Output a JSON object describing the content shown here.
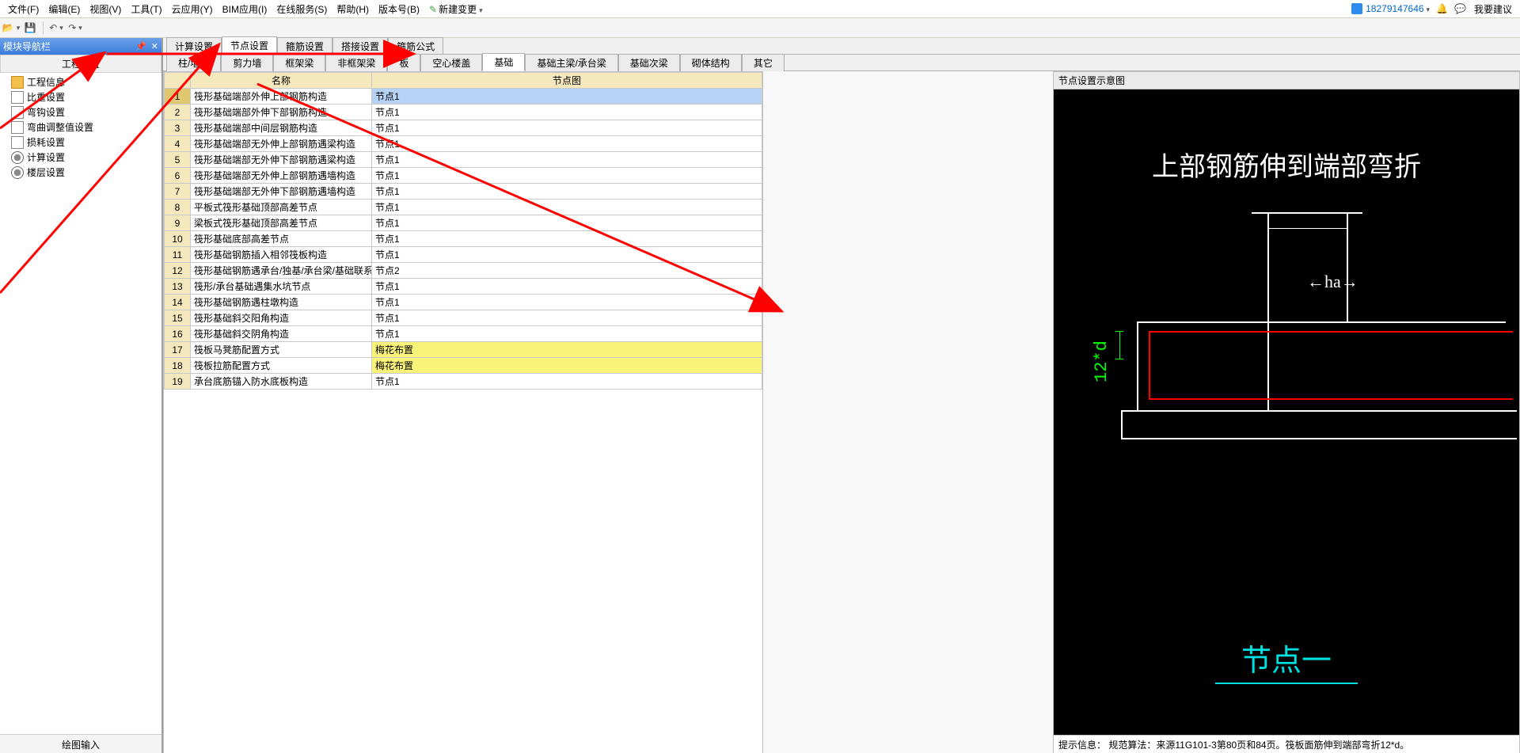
{
  "domain": "Computer-Use",
  "menus": {
    "file": "文件(F)",
    "edit": "编辑(E)",
    "view": "视图(V)",
    "tools": "工具(T)",
    "cloud": "云应用(Y)",
    "bim": "BIM应用(I)",
    "online": "在线服务(S)",
    "help": "帮助(H)",
    "version": "版本号(B)",
    "newchange": "新建变更"
  },
  "menubar_right": {
    "user_id": "18279147646",
    "feedback": "我要建议"
  },
  "nav": {
    "panel_title": "模块导航栏",
    "section": "工程设置",
    "footer": "绘图输入",
    "items": [
      "工程信息",
      "比重设置",
      "弯钩设置",
      "弯曲调整值设置",
      "损耗设置",
      "计算设置",
      "楼层设置"
    ]
  },
  "top_tabs": [
    "计算设置",
    "节点设置",
    "箍筋设置",
    "搭接设置",
    "箍筋公式"
  ],
  "top_tabs_active": 1,
  "sub_tabs": [
    "柱/墙柱",
    "剪力墙",
    "框架梁",
    "非框架梁",
    "板",
    "空心楼盖",
    "基础",
    "基础主梁/承台梁",
    "基础次梁",
    "砌体结构",
    "其它"
  ],
  "sub_tabs_active": 6,
  "table": {
    "headers": {
      "name": "名称",
      "img": "节点图"
    },
    "rows": [
      {
        "idx": 1,
        "name": "筏形基础端部外伸上部钢筋构造",
        "img": "节点1",
        "sel": true
      },
      {
        "idx": 2,
        "name": "筏形基础端部外伸下部钢筋构造",
        "img": "节点1"
      },
      {
        "idx": 3,
        "name": "筏形基础端部中间层钢筋构造",
        "img": "节点1"
      },
      {
        "idx": 4,
        "name": "筏形基础端部无外伸上部钢筋遇梁构造",
        "img": "节点1"
      },
      {
        "idx": 5,
        "name": "筏形基础端部无外伸下部钢筋遇梁构造",
        "img": "节点1"
      },
      {
        "idx": 6,
        "name": "筏形基础端部无外伸上部钢筋遇墙构造",
        "img": "节点1"
      },
      {
        "idx": 7,
        "name": "筏形基础端部无外伸下部钢筋遇墙构造",
        "img": "节点1"
      },
      {
        "idx": 8,
        "name": "平板式筏形基础顶部高差节点",
        "img": "节点1"
      },
      {
        "idx": 9,
        "name": "梁板式筏形基础顶部高差节点",
        "img": "节点1"
      },
      {
        "idx": 10,
        "name": "筏形基础底部高差节点",
        "img": "节点1"
      },
      {
        "idx": 11,
        "name": "筏形基础钢筋插入相邻筏板构造",
        "img": "节点1"
      },
      {
        "idx": 12,
        "name": "筏形基础钢筋遇承台/独基/承台梁/基础联系梁/",
        "img": "节点2"
      },
      {
        "idx": 13,
        "name": "筏形/承台基础遇集水坑节点",
        "img": "节点1"
      },
      {
        "idx": 14,
        "name": "筏形基础钢筋遇柱墩构造",
        "img": "节点1"
      },
      {
        "idx": 15,
        "name": "筏形基础斜交阳角构造",
        "img": "节点1"
      },
      {
        "idx": 16,
        "name": "筏形基础斜交阴角构造",
        "img": "节点1"
      },
      {
        "idx": 17,
        "name": "筏板马凳筋配置方式",
        "img": "梅花布置",
        "hl": true
      },
      {
        "idx": 18,
        "name": "筏板拉筋配置方式",
        "img": "梅花布置",
        "hl": true
      },
      {
        "idx": 19,
        "name": "承台底筋锚入防水底板构造",
        "img": "节点1"
      }
    ]
  },
  "preview": {
    "title": "节点设置示意图",
    "cad_title": "上部钢筋伸到端部弯折",
    "cad_bottom": "节点一",
    "dim_12d": "12*d",
    "dim_ha": "ha",
    "hint_label": "提示信息：",
    "hint_text": "规范算法：来源11G101-3第80页和84页。筏板面筋伸到端部弯折12*d。"
  }
}
